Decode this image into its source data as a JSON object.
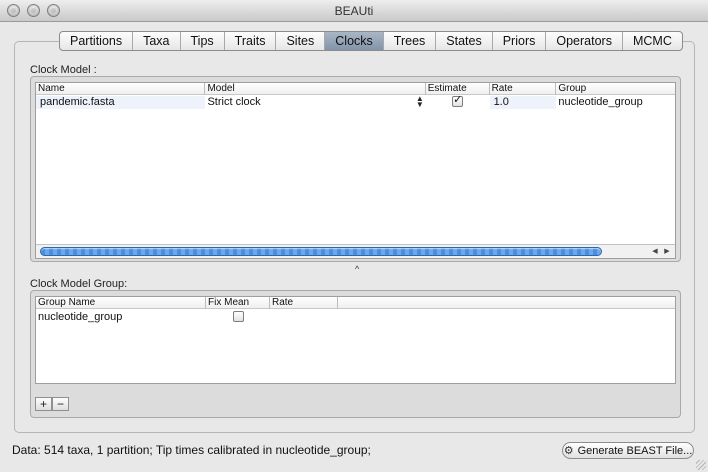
{
  "window": {
    "title": "BEAUti"
  },
  "tabs": [
    {
      "label": "Partitions"
    },
    {
      "label": "Taxa"
    },
    {
      "label": "Tips"
    },
    {
      "label": "Traits"
    },
    {
      "label": "Sites"
    },
    {
      "label": "Clocks",
      "selected": true
    },
    {
      "label": "Trees"
    },
    {
      "label": "States"
    },
    {
      "label": "Priors"
    },
    {
      "label": "Operators"
    },
    {
      "label": "MCMC"
    }
  ],
  "clock_model": {
    "section_label": "Clock Model :",
    "columns": [
      "Name",
      "Model",
      "Estimate",
      "Rate",
      "Group"
    ],
    "rows": [
      {
        "name": "pandemic.fasta",
        "model": "Strict clock",
        "estimate": true,
        "rate": "1.0",
        "group": "nucleotide_group"
      }
    ]
  },
  "clock_model_group": {
    "section_label": "Clock Model Group:",
    "columns": [
      "Group Name",
      "Fix Mean",
      "Rate"
    ],
    "rows": [
      {
        "group_name": "nucleotide_group",
        "fix_mean": false,
        "rate": ""
      }
    ],
    "add_label": "+",
    "remove_label": "−"
  },
  "status": {
    "text": "Data: 514 taxa, 1 partition; Tip times calibrated in nucleotide_group;"
  },
  "generate_button": {
    "label": "Generate BEAST File..."
  },
  "icons": {
    "gear": "gear-icon",
    "stepper": "up-down-stepper-icon",
    "caret": "caret-up-icon"
  },
  "colors": {
    "selected_tab": "#8394aa",
    "scroll_thumb": "#4d8ed8"
  }
}
